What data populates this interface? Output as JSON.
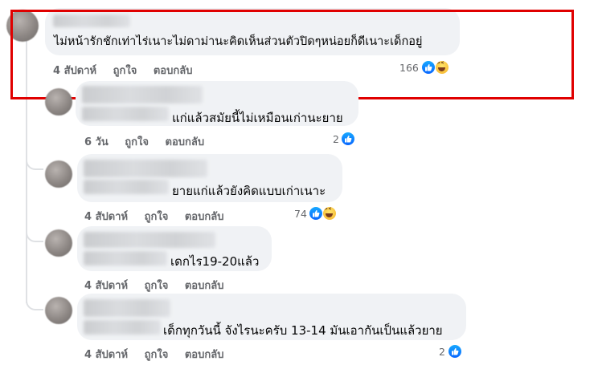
{
  "comments": [
    {
      "text": "ไม่หน้ารักชักเท่าไร่เนาะไม่ดาม่านะคิดเห็นส่วนตัวปิดๆหน่อยก็ดีเนาะเด็กอยู่",
      "time": "4 สัปดาห์",
      "like": "ถูกใจ",
      "reply": "ตอบกลับ",
      "reaction_count": "166",
      "reactions": [
        "like-icon",
        "haha-icon"
      ]
    },
    {
      "text": "แก่แล้วสมัยนี้ไม่เหมือนเก่านะยาย",
      "time": "6 วัน",
      "like": "ถูกใจ",
      "reply": "ตอบกลับ",
      "reaction_count": "2",
      "reactions": [
        "like-icon"
      ]
    },
    {
      "text": "ยายแก่แล้วยังคิดแบบเก่าเนาะ",
      "time": "4 สัปดาห์",
      "like": "ถูกใจ",
      "reply": "ตอบกลับ",
      "reaction_count": "74",
      "reactions": [
        "like-icon",
        "haha-icon"
      ]
    },
    {
      "text": "เดกไร19-20แล้ว",
      "time": "4 สัปดาห์",
      "like": "ถูกใจ",
      "reply": "ตอบกลับ",
      "reaction_count": "",
      "reactions": []
    },
    {
      "text": "เด็กทุกวันนี้ จังไรนะครับ 13-14 มันเอากันเป็นแล้วยาย",
      "time": "4 สัปดาห์",
      "like": "ถูกใจ",
      "reply": "ตอบกลับ",
      "reaction_count": "2",
      "reactions": [
        "like-icon"
      ]
    }
  ],
  "colors": {
    "highlight": "#e00000",
    "bubble": "#f0f2f5",
    "meta": "#65676b",
    "like_blue": "#0866ff"
  }
}
